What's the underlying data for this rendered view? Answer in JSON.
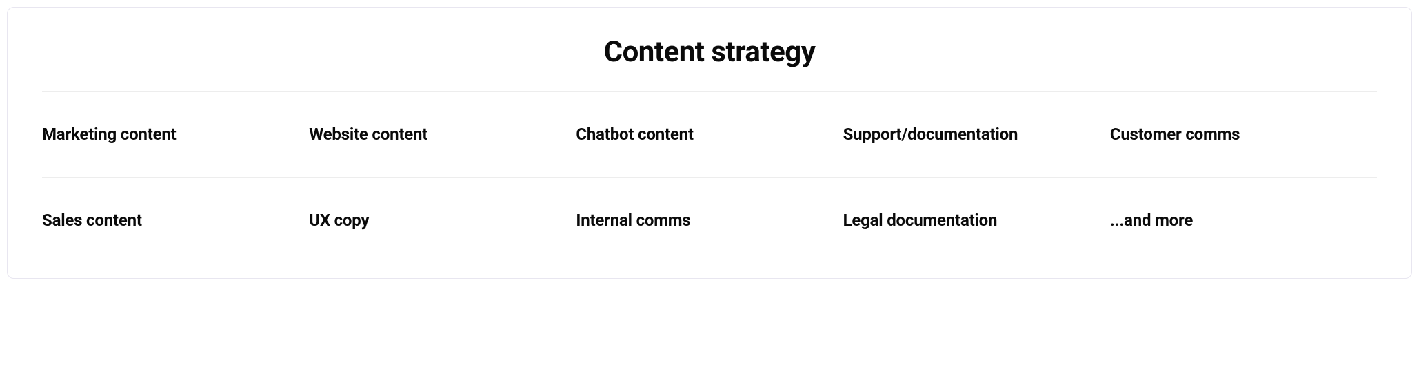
{
  "title": "Content strategy",
  "row1": {
    "c0": "Marketing content",
    "c1": "Website content",
    "c2": "Chatbot content",
    "c3": "Support/documentation",
    "c4": "Customer comms"
  },
  "row2": {
    "c0": "Sales content",
    "c1": "UX copy",
    "c2": "Internal comms",
    "c3": "Legal documentation",
    "c4": "...and more"
  }
}
